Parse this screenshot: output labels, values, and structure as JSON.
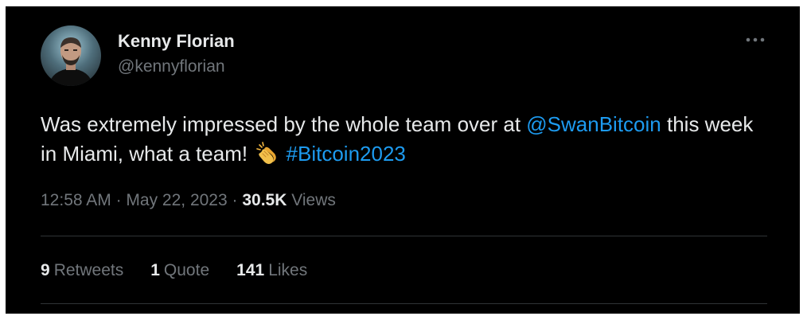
{
  "author": {
    "name": "Kenny Florian",
    "handle": "@kennyflorian"
  },
  "tweet": {
    "text_part1": "Was extremely impressed by the whole team over at ",
    "mention": "@SwanBitcoin",
    "text_part2": " this week in Miami, what a team! ",
    "emoji": "clapping-hands",
    "hashtag": "#Bitcoin2023"
  },
  "meta": {
    "time": "12:58 AM",
    "separator": " · ",
    "date": "May 22, 2023",
    "views_count": "30.5K",
    "views_label": " Views"
  },
  "stats": {
    "retweets_count": "9",
    "retweets_label": "Retweets",
    "quotes_count": "1",
    "quotes_label": "Quote",
    "likes_count": "141",
    "likes_label": "Likes"
  },
  "colors": {
    "background": "#000000",
    "text": "#e7e9ea",
    "secondary_text": "#71767b",
    "link": "#1d9bf0",
    "divider": "#2f3336"
  }
}
